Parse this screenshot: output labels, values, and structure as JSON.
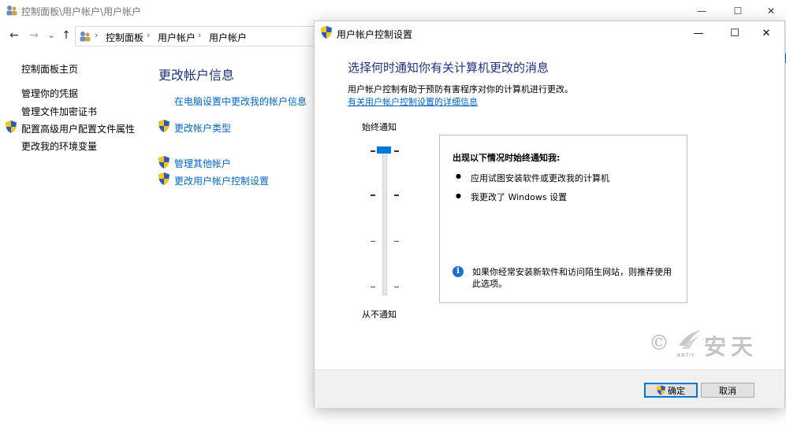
{
  "control_panel": {
    "title": "控制面板\\用户帐户\\用户帐户",
    "caption": {
      "minimize": "—",
      "maximize": "☐",
      "close": "✕"
    },
    "nav": {
      "back": "←",
      "forward": "→",
      "recent": "⌄",
      "up": "↑"
    },
    "breadcrumb": [
      "控制面板",
      "用户帐户",
      "用户帐户"
    ],
    "breadcrumb_sep": "›",
    "sidebar": [
      {
        "label": "控制面板主页"
      },
      {
        "label": "管理你的凭据"
      },
      {
        "label": "管理文件加密证书"
      },
      {
        "label": "配置高级用户配置文件属性"
      },
      {
        "label": "更改我的环境变量"
      }
    ],
    "heading": "更改帐户信息",
    "links": [
      {
        "label": "在电脑设置中更改我的帐户信息"
      },
      {
        "label": "更改帐户类型"
      },
      {
        "label": "管理其他帐户"
      },
      {
        "label": "更改用户帐户控制设置"
      }
    ]
  },
  "dialog": {
    "title": "用户帐户控制设置",
    "caption": {
      "minimize": "—",
      "maximize": "☐",
      "close": "✕"
    },
    "main_title": "选择何时通知你有关计算机更改的消息",
    "description": "用户帐户控制有助于预防有害程序对你的计算机进行更改。",
    "detail_link": "有关用户帐户控制设置的详细信息",
    "slider": {
      "top_label": "始终通知",
      "bottom_label": "从不通知",
      "levels": 4,
      "selected_level": 4
    },
    "info": {
      "heading": "出现以下情况时始终通知我:",
      "bullets": [
        "应用试图安装软件或更改我的计算机",
        "我更改了 Windows 设置"
      ],
      "bullet_char": "●",
      "note": "如果你经常安装新软件和访问陌生网站，则推荐使用此选项。",
      "note_icon": "i"
    },
    "watermark": {
      "symbol": "©",
      "text": "安天",
      "small": "ANTIY"
    },
    "buttons": {
      "ok": "确定",
      "cancel": "取消"
    }
  },
  "colors": {
    "heading_blue": "#1e3287",
    "link_blue": "#0066cc",
    "accent": "#0078d7",
    "footer_bg": "#f0f0f0"
  },
  "icons": [
    "user-accounts-icon",
    "uac-shield-icon",
    "info-icon",
    "watermark-logo"
  ]
}
